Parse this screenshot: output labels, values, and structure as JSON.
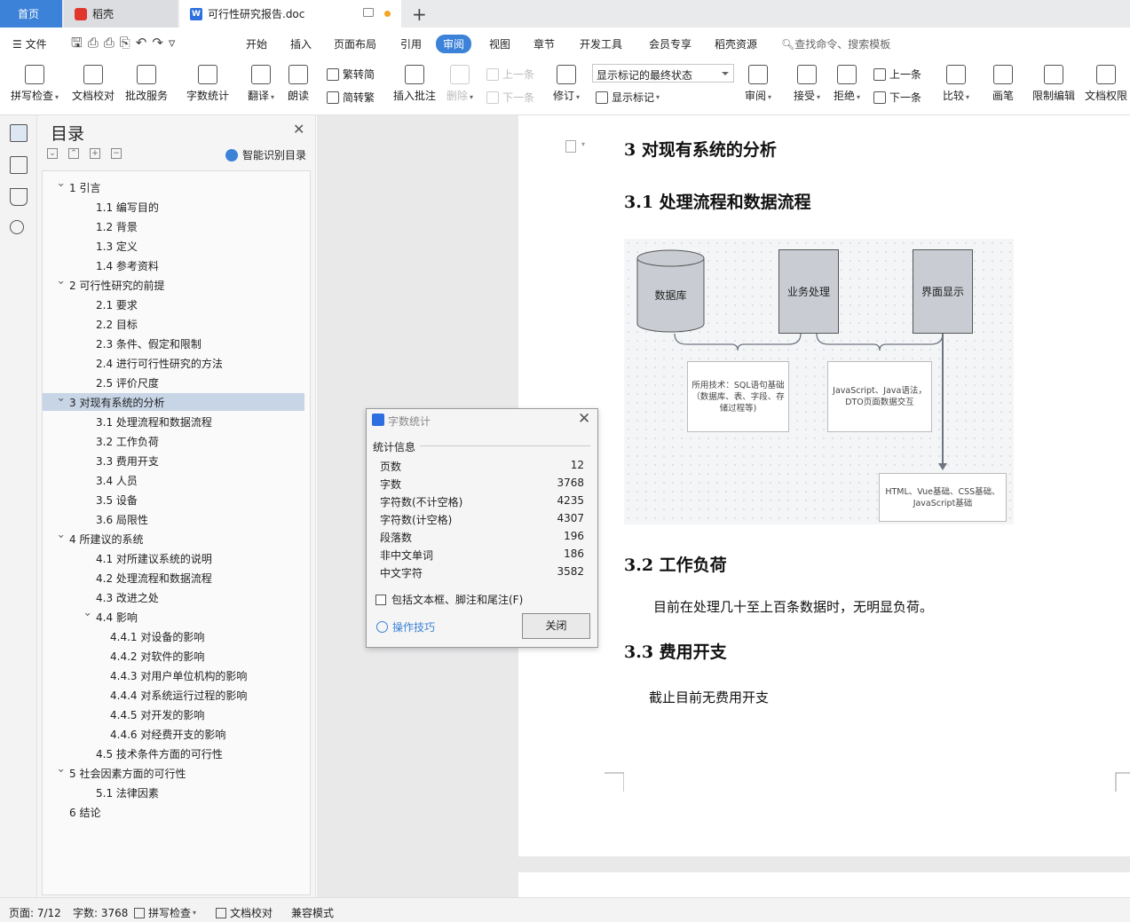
{
  "tabs": {
    "home": "首页",
    "daoke": "稻壳",
    "doc": "可行性研究报告.doc"
  },
  "menu": {
    "file": "文件",
    "start": "开始",
    "insert": "插入",
    "layout": "页面布局",
    "reference": "引用",
    "review": "审阅",
    "view": "视图",
    "chapter": "章节",
    "devtools": "开发工具",
    "vip": "会员专享",
    "daoke": "稻壳资源",
    "search": "查找命令、搜索模板"
  },
  "ribbon": {
    "spell": "拼写检查",
    "proof": "文档校对",
    "batch": "批改服务",
    "wordcount": "字数统计",
    "translate": "翻译",
    "read": "朗读",
    "trad": "繁转简",
    "simp": "简转繁",
    "insert_comment": "插入批注",
    "delete": "删除",
    "prev": "上一条",
    "next": "下一条",
    "track": "修订",
    "markup_state": "显示标记的最终状态",
    "show_markup": "显示标记",
    "review_pane": "审阅",
    "accept": "接受",
    "reject": "拒绝",
    "prev2": "上一条",
    "next2": "下一条",
    "compare": "比较",
    "pen": "画笔",
    "restrict": "限制编辑",
    "rights": "文档权限"
  },
  "toc": {
    "title": "目录",
    "smart": "智能识别目录",
    "items": [
      {
        "label": "1 引言",
        "level": 1,
        "expanded": true
      },
      {
        "label": "1.1 编写目的",
        "level": 2
      },
      {
        "label": "1.2 背景",
        "level": 2
      },
      {
        "label": "1.3 定义",
        "level": 2
      },
      {
        "label": "1.4 参考资料",
        "level": 2
      },
      {
        "label": "2 可行性研究的前提",
        "level": 1,
        "expanded": true
      },
      {
        "label": "2.1 要求",
        "level": 2
      },
      {
        "label": "2.2 目标",
        "level": 2
      },
      {
        "label": "2.3 条件、假定和限制",
        "level": 2
      },
      {
        "label": "2.4 进行可行性研究的方法",
        "level": 2
      },
      {
        "label": "2.5 评价尺度",
        "level": 2
      },
      {
        "label": "3 对现有系统的分析",
        "level": 1,
        "expanded": true,
        "selected": true
      },
      {
        "label": "3.1 处理流程和数据流程",
        "level": 2
      },
      {
        "label": "3.2 工作负荷",
        "level": 2
      },
      {
        "label": "3.3 费用开支",
        "level": 2
      },
      {
        "label": "3.4 人员",
        "level": 2
      },
      {
        "label": "3.5 设备",
        "level": 2
      },
      {
        "label": "3.6 局限性",
        "level": 2
      },
      {
        "label": "4 所建议的系统",
        "level": 1,
        "expanded": true
      },
      {
        "label": "4.1 对所建议系统的说明",
        "level": 2
      },
      {
        "label": "4.2 处理流程和数据流程",
        "level": 2
      },
      {
        "label": "4.3 改进之处",
        "level": 2
      },
      {
        "label": "4.4 影响",
        "level": 2,
        "expanded": true
      },
      {
        "label": "4.4.1 对设备的影响",
        "level": 3
      },
      {
        "label": "4.4.2 对软件的影响",
        "level": 3
      },
      {
        "label": "4.4.3 对用户单位机构的影响",
        "level": 3
      },
      {
        "label": "4.4.4 对系统运行过程的影响",
        "level": 3
      },
      {
        "label": "4.4.5 对开发的影响",
        "level": 3
      },
      {
        "label": "4.4.6 对经费开支的影响",
        "level": 3
      },
      {
        "label": "4.5 技术条件方面的可行性",
        "level": 2
      },
      {
        "label": "5 社会因素方面的可行性",
        "level": 1,
        "expanded": true
      },
      {
        "label": "5.1 法律因素",
        "level": 2
      },
      {
        "label": "6 结论",
        "level": 1
      }
    ]
  },
  "doc": {
    "h3": "3 对现有系统的分析",
    "h31": "3.1 处理流程和数据流程",
    "h32": "3.2 工作负荷",
    "p32": "目前在处理几十至上百条数据时，无明显负荷。",
    "h33": "3.3 费用开支",
    "p33": "截止目前无费用开支"
  },
  "diagram": {
    "db": "数据库",
    "biz": "业务处理",
    "ui": "界面显示",
    "note1": "所用技术：SQL语句基础（数据库、表、字段、存储过程等)",
    "note2": "JavaScript、Java语法，DTO页面数据交互",
    "note3": "HTML、Vue基础、CSS基础、JavaScript基础"
  },
  "dialog": {
    "title": "字数统计",
    "section": "统计信息",
    "rows": [
      {
        "label": "页数",
        "value": "12"
      },
      {
        "label": "字数",
        "value": "3768"
      },
      {
        "label": "字符数(不计空格)",
        "value": "4235"
      },
      {
        "label": "字符数(计空格)",
        "value": "4307"
      },
      {
        "label": "段落数",
        "value": "196"
      },
      {
        "label": "非中文单词",
        "value": "186"
      },
      {
        "label": "中文字符",
        "value": "3582"
      }
    ],
    "checkbox": "包括文本框、脚注和尾注(F)",
    "tips": "操作技巧",
    "close": "关闭"
  },
  "status": {
    "page": "页面: 7/12",
    "words": "字数: 3768",
    "spell": "拼写检查",
    "proof": "文档校对",
    "compat": "兼容模式"
  },
  "colors": {
    "accent": "#3b82d8",
    "box_fill": "#c9cdd3"
  }
}
